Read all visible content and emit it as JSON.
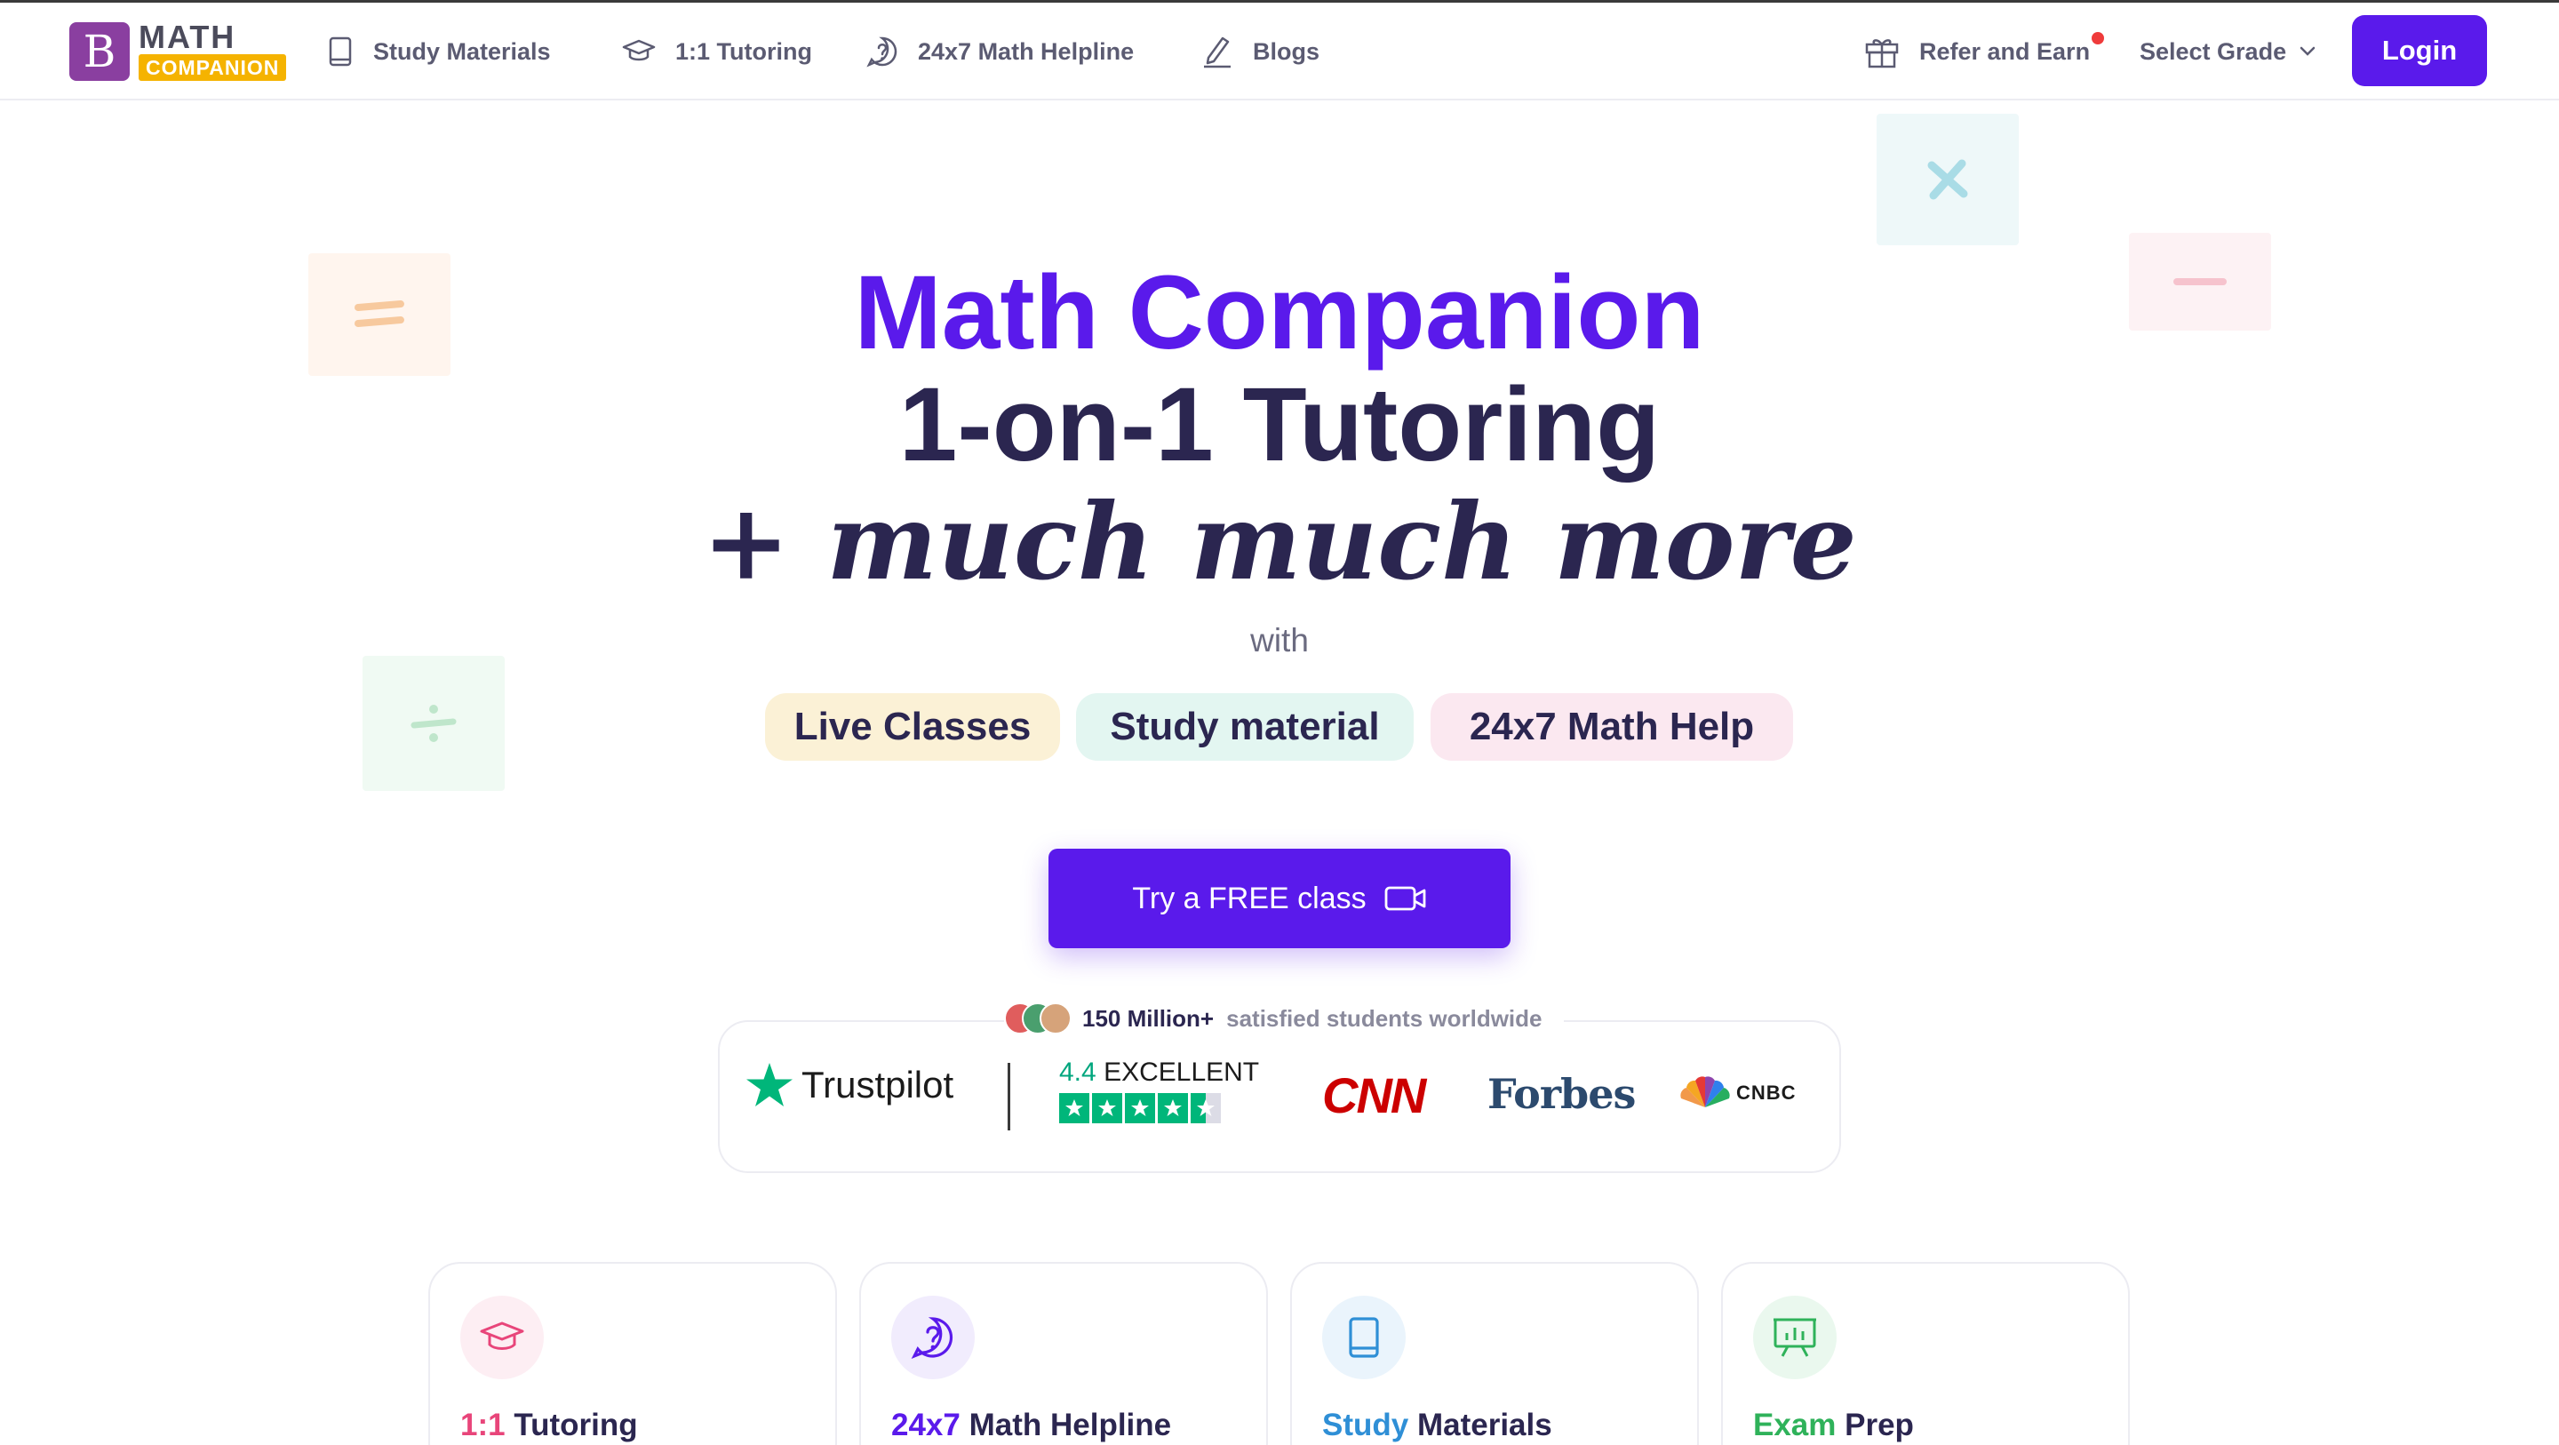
{
  "brand": {
    "logo_letter": "B",
    "name_top": "MATH",
    "name_bottom": "COMPANION"
  },
  "nav": {
    "links": [
      {
        "label": "Study Materials",
        "icon": "book-icon"
      },
      {
        "label": "1:1 Tutoring",
        "icon": "graduation-cap-icon"
      },
      {
        "label": "24x7 Math Helpline",
        "icon": "help-chat-icon"
      },
      {
        "label": "Blogs",
        "icon": "pen-icon"
      }
    ],
    "refer": {
      "label": "Refer and Earn",
      "icon": "gift-icon"
    },
    "grade": {
      "label": "Select Grade",
      "icon": "chevron-down-icon"
    },
    "login_label": "Login"
  },
  "hero": {
    "line1": "Math Companion",
    "line2": "1-on-1 Tutoring",
    "line3": "+ much much more",
    "with": "with",
    "pills": [
      "Live Classes",
      "Study material",
      "24x7 Math Help"
    ],
    "cta_label": "Try a FREE class",
    "cta_icon": "video-camera-icon"
  },
  "decor_symbols": {
    "equals": "=",
    "divide": "÷",
    "multiply": "×",
    "minus": "−"
  },
  "trust": {
    "students_count": "150 Million+",
    "students_text": "satisfied students worldwide",
    "trustpilot_name": "Trustpilot",
    "rating_value": "4.4",
    "rating_word": "EXCELLENT",
    "rating_stars": 4.5,
    "press": [
      "CNN",
      "Forbes",
      "CNBC"
    ]
  },
  "features": [
    {
      "accent": "1:1",
      "rest": " Tutoring",
      "accent_color": "#e8457a",
      "icon": "graduation-cap-icon",
      "icon_bg": "#fdeef3"
    },
    {
      "accent": "24x7",
      "rest": " Math Helpline",
      "accent_color": "#5a1aeb",
      "icon": "help-chat-icon",
      "icon_bg": "#f1ecfd"
    },
    {
      "accent": "Study",
      "rest": " Materials",
      "accent_color": "#2f8fd6",
      "icon": "book-icon",
      "icon_bg": "#eaf4fc"
    },
    {
      "accent": "Exam",
      "rest": " Prep",
      "accent_color": "#2fb25a",
      "icon": "presentation-chart-icon",
      "icon_bg": "#eaf8ee"
    }
  ],
  "colors": {
    "primary": "#5a1aeb",
    "heading": "#2b2650",
    "trustpilot_green": "#00b67a",
    "cnn_red": "#cc0000"
  }
}
